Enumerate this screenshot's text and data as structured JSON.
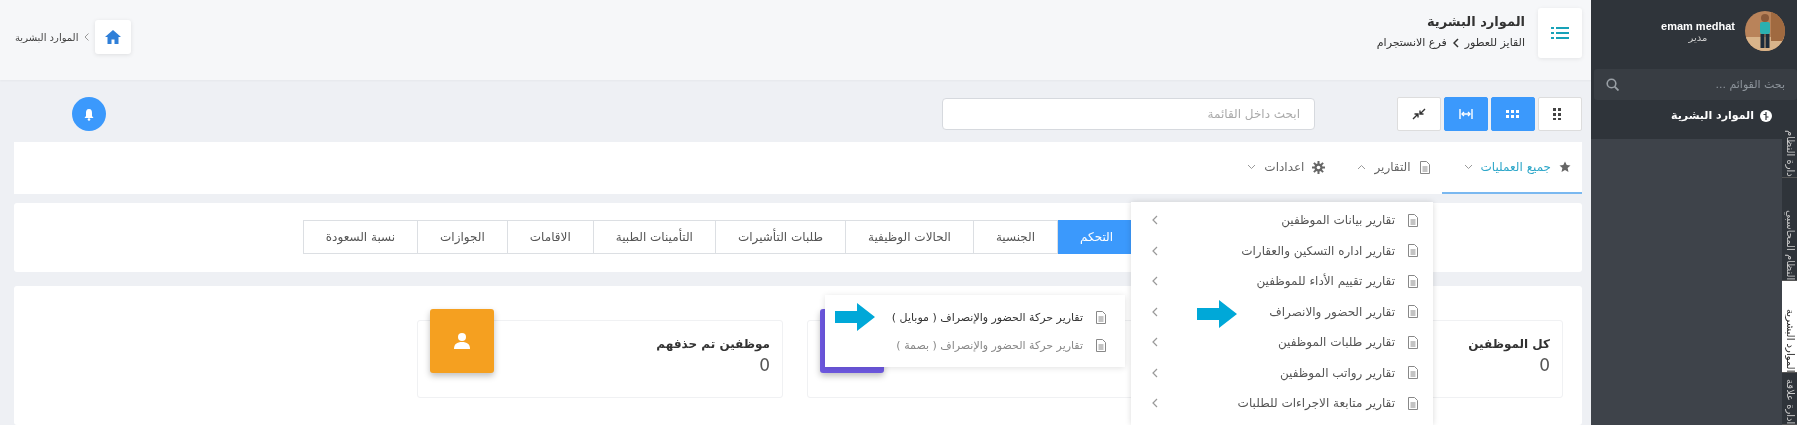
{
  "sidebar": {
    "user": {
      "name": "emam medhat",
      "role": "مدير"
    },
    "search": {
      "placeholder": "بحث القوائم ..."
    },
    "items": [
      {
        "label": "الموارد البشرية"
      }
    ],
    "module_tabs": [
      {
        "label": "دارة النظام",
        "selected": false
      },
      {
        "label": "النظام المحاسبي",
        "selected": false
      },
      {
        "label": "الموارد البشرية",
        "selected": true
      },
      {
        "label": "ادارة علاقة",
        "selected": false
      }
    ]
  },
  "header": {
    "title": "الموارد البشرية",
    "breadcrumb": [
      "القايز للعطور",
      "فرع الانستجرام"
    ],
    "page_crumb": "الموارد البشرية"
  },
  "toolbar": {
    "search": {
      "placeholder": "ابحث داخل القائمة"
    },
    "view_buttons": [
      {
        "kind": "grid",
        "on": false
      },
      {
        "kind": "dots",
        "on": true
      },
      {
        "kind": "expand",
        "on": true
      },
      {
        "kind": "compress",
        "on": false
      }
    ]
  },
  "nav": [
    {
      "label": "جميع العمليات",
      "selected": true,
      "expanded": false
    },
    {
      "label": "التقارير",
      "selected": false,
      "expanded": true
    },
    {
      "label": "اعدادات",
      "selected": false,
      "expanded": false
    }
  ],
  "tabs": [
    {
      "label": "التحكم",
      "selected": true
    },
    {
      "label": "الجنسية",
      "selected": false
    },
    {
      "label": "الحالات الوظيفية",
      "selected": false
    },
    {
      "label": "طلبات التأشيرات",
      "selected": false
    },
    {
      "label": "التأمينات الطبية",
      "selected": false
    },
    {
      "label": "الاقامات",
      "selected": false
    },
    {
      "label": "الجوازات",
      "selected": false
    },
    {
      "label": "نسبة السعودة",
      "selected": false
    }
  ],
  "stats": [
    {
      "label": "كل الموظفين",
      "value": "0"
    },
    {
      "color": "#6c57de"
    },
    {
      "label": "موظفين تم حذفهم",
      "value": "0",
      "color": "#f5a020"
    }
  ],
  "report_menu": {
    "items": [
      {
        "label": "تقارير بيانات الموظفين"
      },
      {
        "label": "تقارير اداره التسكين والعقارات"
      },
      {
        "label": "تقارير تقييم الأداء للموظفين"
      },
      {
        "label": "تقارير الحضور والانصراف",
        "pointed": true
      },
      {
        "label": "تقارير طلبات الموظفين"
      },
      {
        "label": "تقارير رواتب الموظفين"
      },
      {
        "label": "تقارير متابعة الاجراءات للطلبات"
      }
    ]
  },
  "submenu": {
    "items": [
      {
        "label": "تقارير حركة الحضور والإنصراف ( موبايل )",
        "selected": true,
        "pointed": true
      },
      {
        "label": "تقارير حركة الحضور والإنصراف ( بصمة )",
        "selected": false,
        "pointed": false
      }
    ]
  }
}
